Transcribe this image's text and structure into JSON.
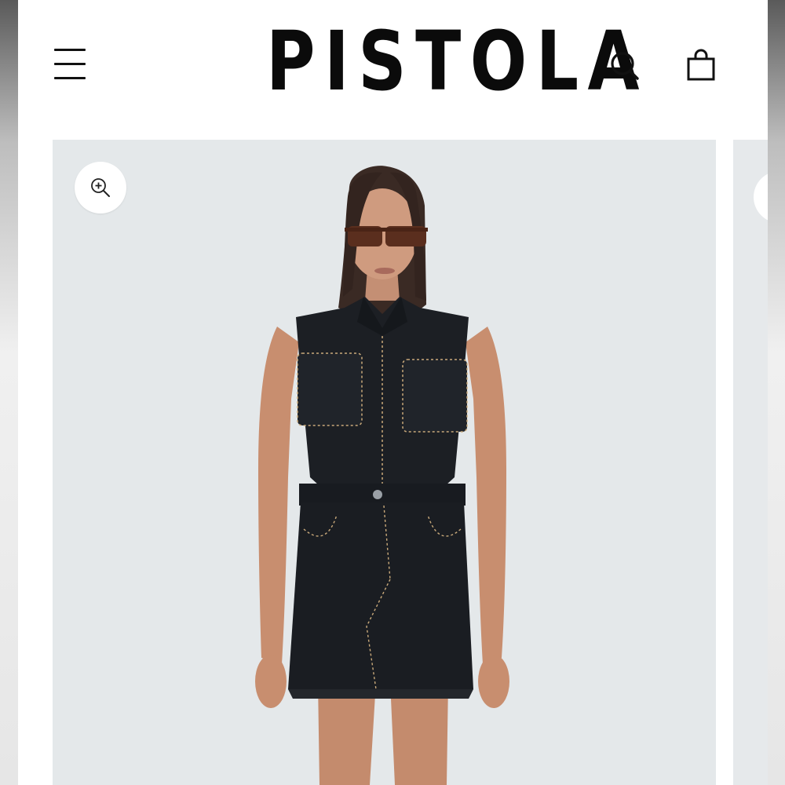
{
  "header": {
    "brand": "PISTOLA",
    "menu_icon": "hamburger-menu-icon",
    "search_icon": "search-icon",
    "bag_icon": "shopping-bag-icon"
  },
  "product_gallery": {
    "zoom_icon": "zoom-in-icon",
    "image_subject": "model-wearing-black-sleeveless-denim-mini-dress",
    "background_color": "#e4e8ea"
  },
  "colors": {
    "brand_text": "#0b0b0b",
    "dress": "#1c1f24",
    "stitching": "#c9a97a"
  }
}
